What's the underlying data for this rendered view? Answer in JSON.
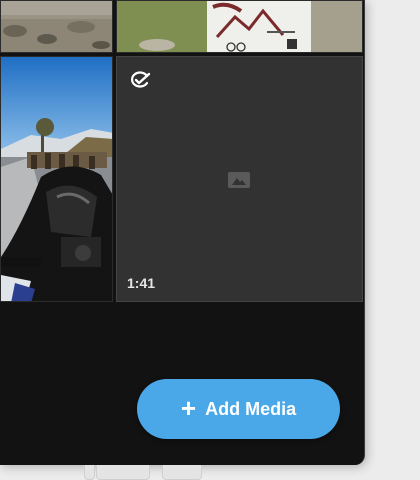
{
  "media_grid": {
    "tiles": [
      {
        "kind": "photo",
        "subject": "stone wall and gravel"
      },
      {
        "kind": "photo",
        "subject": "mountain sign with cycling logo"
      },
      {
        "kind": "photo",
        "subject": "motorcycle on alpine road"
      },
      {
        "kind": "video",
        "subject": "video placeholder",
        "duration": "1:41",
        "badge_icon": "check-badge-icon",
        "placeholder_icon": "image-icon"
      }
    ]
  },
  "actions": {
    "add_media_label": "Add Media",
    "add_media_icon": "plus-icon"
  },
  "colors": {
    "panel_bg": "#121212",
    "tile_bg": "#323232",
    "accent": "#4ba8e8"
  }
}
